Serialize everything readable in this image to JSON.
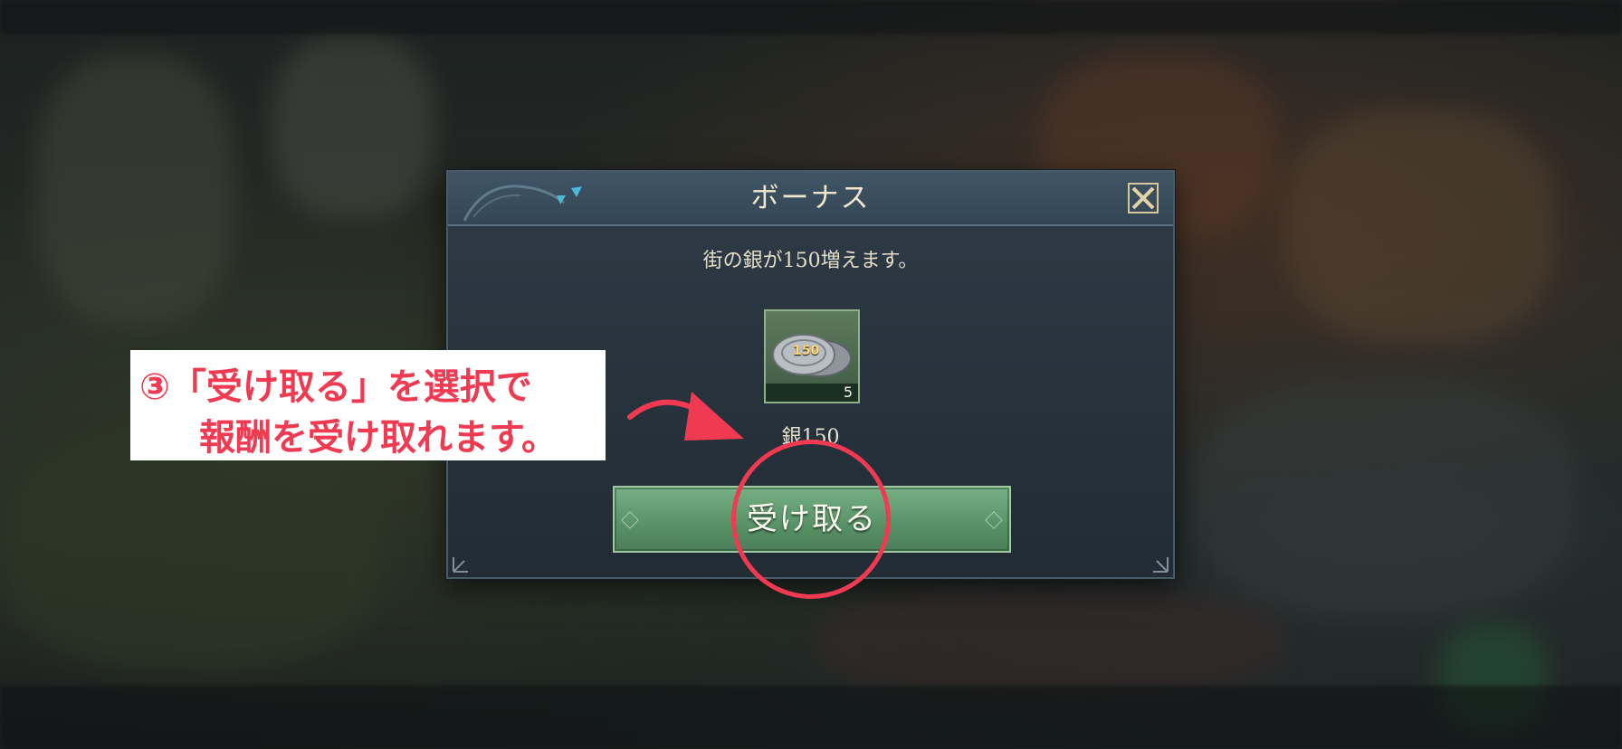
{
  "dialog": {
    "title": "ボーナス",
    "message": "街の銀が150増えます。",
    "reward": {
      "icon": "silver-coins-icon",
      "coin_label": "150",
      "count": "5",
      "name": "銀150"
    },
    "claim_button_label": "受け取る"
  },
  "annotation": {
    "line1": "③「受け取る」を選択で",
    "line2": "報酬を受け取れます。",
    "color": "#ef3a52"
  }
}
